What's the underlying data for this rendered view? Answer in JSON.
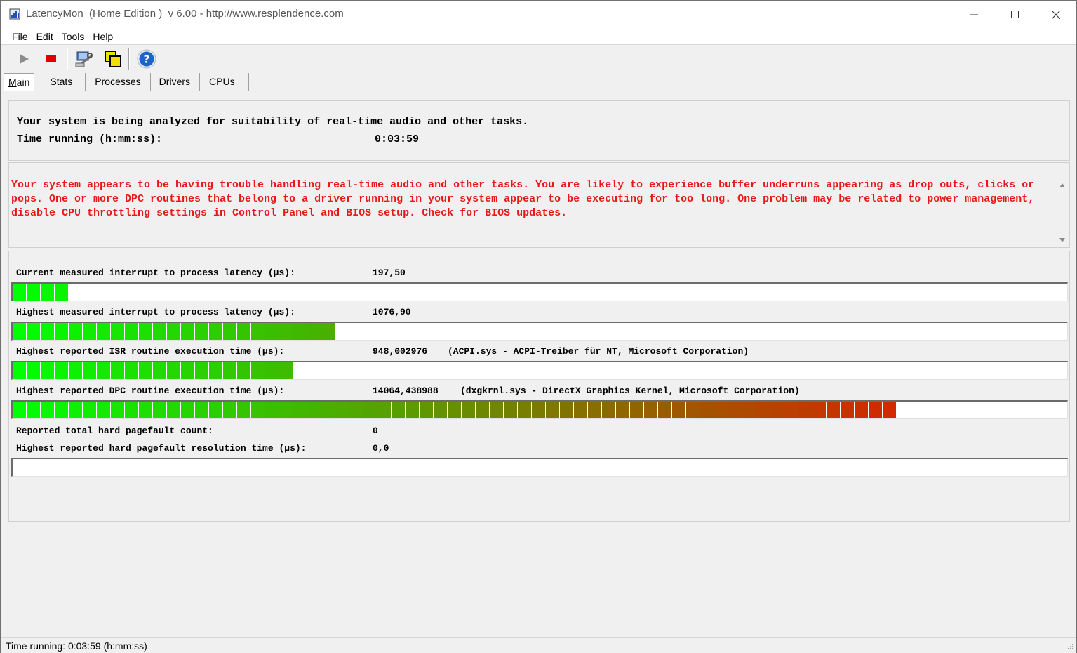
{
  "window": {
    "title": "LatencyMon  (Home Edition )  v 6.00 - http://www.resplendence.com"
  },
  "menu": [
    {
      "hot": "F",
      "rest": "ile"
    },
    {
      "hot": "E",
      "rest": "dit"
    },
    {
      "hot": "T",
      "rest": "ools"
    },
    {
      "hot": "H",
      "rest": "elp"
    }
  ],
  "toolbar": {
    "icons": [
      "play-icon",
      "stop-icon",
      "tools-icon",
      "copy-icon",
      "help-icon"
    ],
    "stop_color": "#e00000",
    "help_color": "#1e64c8"
  },
  "tabs": [
    {
      "hot": "M",
      "rest": "ain",
      "active": true
    },
    {
      "hot": "S",
      "rest": "tats"
    },
    {
      "hot": "P",
      "rest": "rocesses"
    },
    {
      "hot": "D",
      "rest": "rivers"
    },
    {
      "hot": "C",
      "rest": "PUs"
    }
  ],
  "summary": {
    "line1": "Your system is being analyzed for suitability of real-time audio and other tasks.",
    "time_label": "Time running (h:mm:ss):",
    "time_value": "0:03:59"
  },
  "warning": {
    "text": "Your system appears to be having trouble handling real-time audio and other tasks. You are likely to experience buffer underruns appearing as drop outs, clicks or pops. One or more DPC routines that belong to a driver running in your system appear to be executing for too long. One problem may be related to power management, disable CPU throttling settings in Control Panel and BIOS setup. Check for BIOS updates.",
    "color": "#e81818"
  },
  "metrics": [
    {
      "label": "Current measured interrupt to process latency (µs):",
      "value": "197,50",
      "extra": "",
      "fill_segments": 4
    },
    {
      "label": "Highest measured interrupt to process latency (µs):",
      "value": "1076,90",
      "extra": "",
      "fill_segments": 23
    },
    {
      "label": "Highest reported ISR routine execution time (µs):",
      "value": "948,002976",
      "extra": "(ACPI.sys - ACPI-Treiber für NT, Microsoft Corporation)",
      "fill_segments": 20
    },
    {
      "label": "Highest reported DPC routine execution time (µs):",
      "value": "14064,438988",
      "extra": "(dxgkrnl.sys - DirectX Graphics Kernel, Microsoft Corporation)",
      "fill_segments": 63
    }
  ],
  "meter_total_segments": 75,
  "meter_colors": {
    "start": "#00ff00",
    "mid": "#7a7a00",
    "end": "#ff0000"
  },
  "pagefault": {
    "count_label": "Reported total hard pagefault count:",
    "count_value": "0",
    "time_label": "Highest reported hard pagefault resolution time (µs):",
    "time_value": "0,0",
    "fill_segments": 0
  },
  "status": {
    "text": "Time running: 0:03:59  (h:mm:ss)"
  }
}
